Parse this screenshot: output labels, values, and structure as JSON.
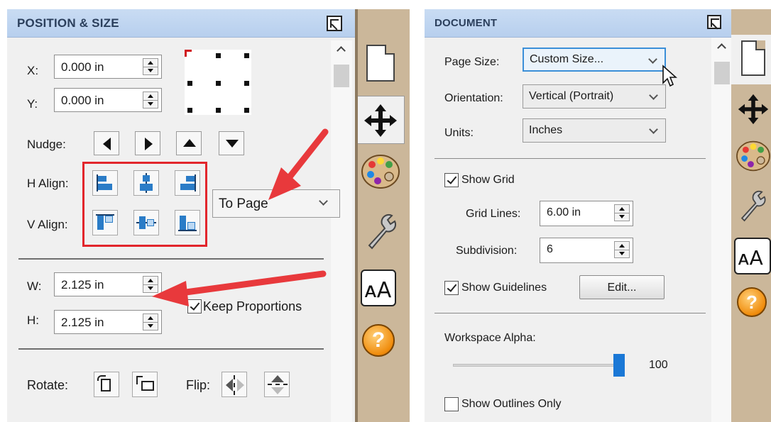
{
  "left_panel": {
    "title": "POSITION & SIZE",
    "x_label": "X:",
    "x_value": "0.000 in",
    "y_label": "Y:",
    "y_value": "0.000 in",
    "nudge_label": "Nudge:",
    "h_align_label": "H Align:",
    "v_align_label": "V Align:",
    "align_to_select": "To Page",
    "w_label": "W:",
    "w_value": "2.125 in",
    "h_label": "H:",
    "h_value": "2.125 in",
    "keep_proportions_label": "Keep Proportions",
    "keep_proportions_checked": true,
    "rotate_label": "Rotate:",
    "flip_label": "Flip:"
  },
  "right_panel": {
    "title": "DOCUMENT",
    "page_size_label": "Page Size:",
    "page_size_value": "Custom Size...",
    "orientation_label": "Orientation:",
    "orientation_value": "Vertical (Portrait)",
    "units_label": "Units:",
    "units_value": "Inches",
    "show_grid_label": "Show Grid",
    "show_grid_checked": true,
    "grid_lines_label": "Grid Lines:",
    "grid_lines_value": "6.00 in",
    "subdivision_label": "Subdivision:",
    "subdivision_value": "6",
    "show_guidelines_label": "Show Guidelines",
    "show_guidelines_checked": true,
    "edit_button": "Edit...",
    "workspace_alpha_label": "Workspace Alpha:",
    "workspace_alpha_value": "100",
    "workspace_alpha_fraction": 1.0,
    "show_outlines_label": "Show Outlines Only",
    "show_outlines_checked": false
  },
  "tabs": [
    "document-tab",
    "position-size-tab",
    "color-palette-tab",
    "tools-tab",
    "text-tab",
    "help-tab"
  ],
  "colors": {
    "title_bar": "#c1d6f1",
    "panel_bg": "#f0f0f0",
    "tab_column": "#cbb79a",
    "annotation_red": "#e2262c",
    "accent_blue": "#1a78d6"
  }
}
